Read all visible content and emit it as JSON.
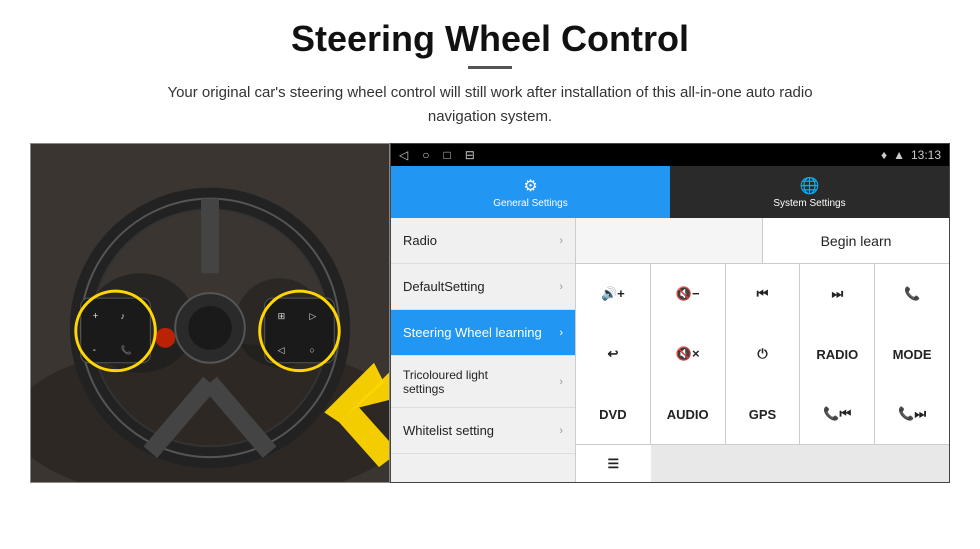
{
  "header": {
    "title": "Steering Wheel Control",
    "subtitle": "Your original car's steering wheel control will still work after installation of this all-in-one auto radio navigation system."
  },
  "status_bar": {
    "time": "13:13",
    "nav_icons": [
      "◁",
      "○",
      "□",
      "⊟"
    ]
  },
  "tabs": [
    {
      "id": "general",
      "label": "General Settings",
      "icon": "⚙",
      "active": true
    },
    {
      "id": "system",
      "label": "System Settings",
      "icon": "🌐",
      "active": false
    }
  ],
  "menu_items": [
    {
      "id": "radio",
      "label": "Radio",
      "active": false
    },
    {
      "id": "default-setting",
      "label": "DefaultSetting",
      "active": false
    },
    {
      "id": "steering-wheel",
      "label": "Steering Wheel learning",
      "active": true
    },
    {
      "id": "tricoloured",
      "label": "Tricoloured light settings",
      "active": false
    },
    {
      "id": "whitelist",
      "label": "Whitelist setting",
      "active": false
    }
  ],
  "controls": {
    "begin_learn": "Begin learn",
    "buttons_row1": [
      {
        "id": "vol-up",
        "label": "🔊+",
        "type": "icon"
      },
      {
        "id": "vol-down",
        "label": "🔇-",
        "type": "icon"
      },
      {
        "id": "prev-track",
        "label": "⏮",
        "type": "icon"
      },
      {
        "id": "next-track",
        "label": "⏭",
        "type": "icon"
      },
      {
        "id": "phone",
        "label": "📞",
        "type": "icon"
      }
    ],
    "buttons_row2": [
      {
        "id": "back",
        "label": "↩",
        "type": "icon"
      },
      {
        "id": "mute",
        "label": "🔇×",
        "type": "icon"
      },
      {
        "id": "power",
        "label": "⏻",
        "type": "icon"
      },
      {
        "id": "radio-btn",
        "label": "RADIO",
        "type": "text"
      },
      {
        "id": "mode",
        "label": "MODE",
        "type": "text"
      }
    ],
    "buttons_row3": [
      {
        "id": "dvd",
        "label": "DVD",
        "type": "text"
      },
      {
        "id": "audio",
        "label": "AUDIO",
        "type": "text"
      },
      {
        "id": "gps",
        "label": "GPS",
        "type": "text"
      },
      {
        "id": "phone-prev",
        "label": "📞⏮",
        "type": "icon"
      },
      {
        "id": "phone-next",
        "label": "📞⏭",
        "type": "icon"
      }
    ],
    "buttons_row4": [
      {
        "id": "list",
        "label": "≡",
        "type": "icon"
      }
    ]
  }
}
